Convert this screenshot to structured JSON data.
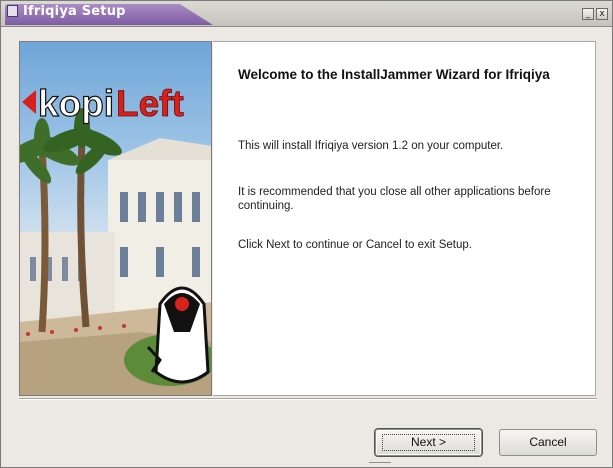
{
  "window": {
    "title": "Ifriqiya Setup"
  },
  "banner": {
    "logo_text_kopi": "kopi",
    "logo_text_left": "Left"
  },
  "content": {
    "heading": "Welcome to the InstallJammer Wizard for Ifriqiya",
    "paragraphs": [
      "This will install Ifriqiya version 1.2 on your computer.",
      "It is recommended that you close all other applications before  continuing.",
      "Click Next to continue or Cancel to exit Setup."
    ]
  },
  "buttons": {
    "next": "Next >",
    "cancel": "Cancel"
  },
  "wm": {
    "minimize": "_",
    "close": "x"
  },
  "colors": {
    "title_accent": "#8a6bb0",
    "logo_red": "#d8201c"
  },
  "icons": [
    "app-icon",
    "minimize-icon",
    "close-icon"
  ]
}
